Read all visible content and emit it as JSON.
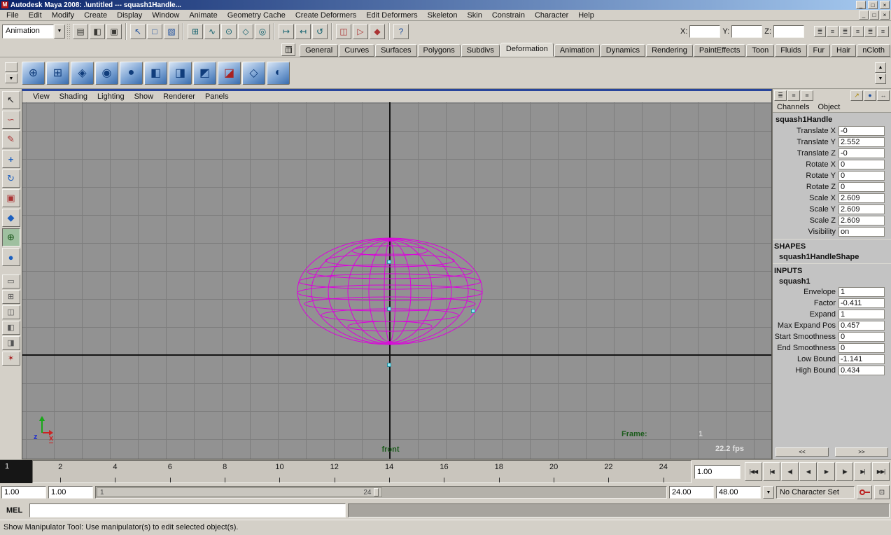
{
  "colors": {
    "titlebar_left": "#0a246a",
    "titlebar_right": "#a6caf0",
    "face": "#d4d0c8",
    "panel": "#c3c3c3",
    "viewport": "#929292",
    "grid": "#7d7d7d",
    "axis": "#151515",
    "wireframe": "#dd00dd",
    "handle": "#8fe9f5",
    "hud_green": "#1c5c1c",
    "active_panel": "#27449b"
  },
  "titlebar": {
    "app_icon_letter": "M",
    "title": "Autodesk Maya 2008: .\\untitled  ---  squash1Handle...",
    "minimize": "_",
    "maximize": "□",
    "close": "×"
  },
  "menubar": {
    "items": [
      "File",
      "Edit",
      "Modify",
      "Create",
      "Display",
      "Window",
      "Animate",
      "Geometry Cache",
      "Create Deformers",
      "Edit Deformers",
      "Skeleton",
      "Skin",
      "Constrain",
      "Character",
      "Help"
    ],
    "minimize": "_",
    "restore": "□",
    "close": "×"
  },
  "statusline": {
    "menuset": "Animation",
    "dropdown_arrow": "▼",
    "icons": {
      "new_scene": "▤",
      "open_scene": "◧",
      "save_scene": "▣",
      "select_hierarchy": "↖",
      "select_object": "□",
      "select_component": "▧",
      "snap_grid": "⊞",
      "snap_curve": "∿",
      "snap_point": "⊙",
      "snap_plane": "◇",
      "make_live": "◎",
      "input_connections": "↦",
      "output_connections": "↤",
      "construction_history": "↺",
      "render_current": "◫",
      "ipr_render": "▷",
      "render_globals": "◆",
      "quick_help": "?",
      "ui_toggle_a": "≣",
      "ui_toggle_b": "≡"
    },
    "coords": {
      "x_label": "X:",
      "x_value": "",
      "y_label": "Y:",
      "y_value": "",
      "z_label": "Z:",
      "z_value": ""
    }
  },
  "shelf": {
    "tabs": [
      "General",
      "Curves",
      "Surfaces",
      "Polygons",
      "Subdivs",
      "Deformation",
      "Animation",
      "Dynamics",
      "Rendering",
      "PaintEffects",
      "Toon",
      "Fluids",
      "Fur",
      "Hair",
      "nCloth"
    ],
    "menu_arrow": "▼",
    "scroll_up": "▲",
    "scroll_down": "▼",
    "items": [
      {
        "name": "shelf-blend-shape-icon",
        "glyph": "⊕"
      },
      {
        "name": "shelf-lattice-icon",
        "glyph": "⊞"
      },
      {
        "name": "shelf-wrap-icon",
        "glyph": "◈"
      },
      {
        "name": "shelf-cluster-icon",
        "glyph": "◉"
      },
      {
        "name": "shelf-soft-mod-icon",
        "glyph": "●"
      },
      {
        "name": "shelf-bend-deformer-icon",
        "glyph": "◧"
      },
      {
        "name": "shelf-flare-deformer-icon",
        "glyph": "◨"
      },
      {
        "name": "shelf-sine-deformer-icon",
        "glyph": "◩"
      },
      {
        "name": "shelf-squash-deformer-icon",
        "glyph": "◪"
      },
      {
        "name": "shelf-twist-deformer-icon",
        "glyph": "◇"
      },
      {
        "name": "shelf-wave-deformer-icon",
        "glyph": "◐"
      }
    ]
  },
  "toolbox": {
    "select": "↖",
    "lasso": "∽",
    "paint_select": "✎",
    "move": "+",
    "rotate": "↻",
    "scale": "▣",
    "universal": "◆",
    "show_manip": "⊕",
    "last_tool": "●",
    "layouts": [
      {
        "name": "single-pane-layout-button",
        "glyph": "▭"
      },
      {
        "name": "four-pane-layout-button",
        "glyph": "⊞"
      },
      {
        "name": "two-pane-layout-button",
        "glyph": "◫"
      },
      {
        "name": "persp-outliner-layout-button",
        "glyph": "◧"
      },
      {
        "name": "persp-graph-layout-button",
        "glyph": "◨"
      },
      {
        "name": "paint-effects-panel-button",
        "glyph": "✶"
      }
    ]
  },
  "viewport": {
    "menu": [
      "View",
      "Shading",
      "Lighting",
      "Show",
      "Renderer",
      "Panels"
    ],
    "camera": "front",
    "frame_label": "Frame:",
    "frame_value": "1",
    "fps": "22.2 fps",
    "axis_z_label": "z",
    "axis_x_label": "x"
  },
  "channel_box": {
    "icons": {
      "display_wide": "≣",
      "display_list": "≡",
      "display_narrow": "≡",
      "manip_arrow": "↗",
      "manip_sphere": "●",
      "manip_speed": "↔"
    },
    "menu_channels": "Channels",
    "menu_object": "Object",
    "node_name": "squash1Handle",
    "channels": [
      {
        "label": "Translate X",
        "value": "-0"
      },
      {
        "label": "Translate Y",
        "value": "2.552"
      },
      {
        "label": "Translate Z",
        "value": "-0"
      },
      {
        "label": "Rotate X",
        "value": "0"
      },
      {
        "label": "Rotate Y",
        "value": "0"
      },
      {
        "label": "Rotate Z",
        "value": "0"
      },
      {
        "label": "Scale X",
        "value": "2.609"
      },
      {
        "label": "Scale Y",
        "value": "2.609"
      },
      {
        "label": "Scale Z",
        "value": "2.609"
      },
      {
        "label": "Visibility",
        "value": "on"
      }
    ],
    "shapes_label": "SHAPES",
    "shape_node": "squash1HandleShape",
    "inputs_label": "INPUTS",
    "input_node": "squash1",
    "input_channels": [
      {
        "label": "Envelope",
        "value": "1"
      },
      {
        "label": "Factor",
        "value": "-0.411"
      },
      {
        "label": "Expand",
        "value": "1"
      },
      {
        "label": "Max Expand Pos",
        "value": "0.457"
      },
      {
        "label": "Start Smoothness",
        "value": "0"
      },
      {
        "label": "End Smoothness",
        "value": "0"
      },
      {
        "label": "Low Bound",
        "value": "-1.141"
      },
      {
        "label": "High Bound",
        "value": "0.434"
      }
    ],
    "nav_left": "<<",
    "nav_right": ">>"
  },
  "timeline": {
    "current_frame": "1",
    "ticks": [
      "2",
      "4",
      "6",
      "8",
      "10",
      "12",
      "14",
      "16",
      "18",
      "20",
      "22",
      "24"
    ],
    "current_time": "1.00",
    "playback": [
      {
        "name": "go-to-start-button",
        "glyph": "|◀◀"
      },
      {
        "name": "step-back-key-button",
        "glyph": "|◀"
      },
      {
        "name": "step-back-frame-button",
        "glyph": "◀|"
      },
      {
        "name": "play-backward-button",
        "glyph": "◀"
      },
      {
        "name": "play-forward-button",
        "glyph": "▶"
      },
      {
        "name": "step-forward-frame-button",
        "glyph": "|▶"
      },
      {
        "name": "step-forward-key-button",
        "glyph": "▶|"
      },
      {
        "name": "go-to-end-button",
        "glyph": "▶▶|"
      }
    ]
  },
  "range_slider": {
    "anim_start": "1.00",
    "play_start": "1.00",
    "range_start_label": "1",
    "range_end_label": "24",
    "play_end": "24.00",
    "anim_end": "48.00",
    "dropdown_arrow": "▼",
    "character_set": "No Character Set"
  },
  "command_line": {
    "label": "MEL",
    "input_value": ""
  },
  "help_line": {
    "text": "Show Manipulator Tool: Use manipulator(s) to edit selected object(s)."
  }
}
